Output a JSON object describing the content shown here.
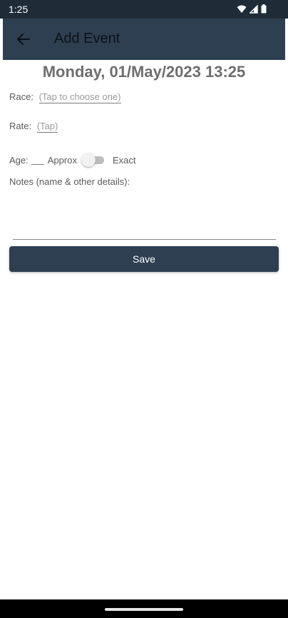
{
  "status": {
    "time": "1:25",
    "icons": [
      "wifi-icon",
      "signal-icon",
      "battery-icon"
    ]
  },
  "appbar": {
    "title": "Add Event",
    "back_icon": "arrow-left-icon"
  },
  "form": {
    "date": "Monday, 01/May/2023 13:25",
    "race_label": "Race:",
    "race_placeholder": "(Tap to choose one)",
    "rate_label": "Rate:",
    "rate_placeholder": "(Tap)",
    "age_label": "Age:",
    "age_value": "",
    "approx_label": "Approx",
    "exact_label": "Exact",
    "age_toggle_on": false,
    "notes_label": "Notes (name & other details):",
    "notes_value": ""
  },
  "actions": {
    "save_label": "Save"
  },
  "colors": {
    "primary": "#2e3f52",
    "status_bar": "#1f2c38",
    "title_text": "#6e6e6e"
  }
}
